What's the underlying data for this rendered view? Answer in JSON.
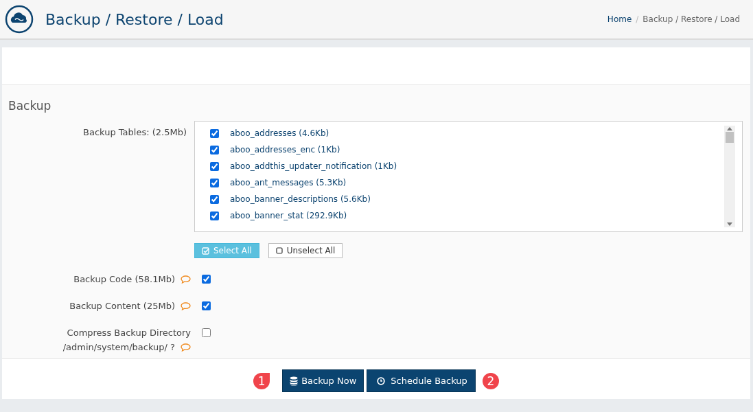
{
  "header": {
    "title": "Backup / Restore / Load",
    "breadcrumb": [
      {
        "label": "Home",
        "link": true
      },
      {
        "label": "Backup / Restore / Load",
        "link": false
      }
    ],
    "separator": "/"
  },
  "section": {
    "heading": "Backup"
  },
  "tables": {
    "label": "Backup Tables: (2.5Mb)",
    "items": [
      {
        "name": "aboo_addresses (4.6Kb)",
        "checked": true
      },
      {
        "name": "aboo_addresses_enc (1Kb)",
        "checked": true
      },
      {
        "name": "aboo_addthis_updater_notification (1Kb)",
        "checked": true
      },
      {
        "name": "aboo_ant_messages (5.3Kb)",
        "checked": true
      },
      {
        "name": "aboo_banner_descriptions (5.6Kb)",
        "checked": true
      },
      {
        "name": "aboo_banner_stat (292.9Kb)",
        "checked": true
      }
    ],
    "buttons": [
      {
        "label": "Select All",
        "kind": "select"
      },
      {
        "label": "Unselect All",
        "kind": "unselect"
      }
    ]
  },
  "options": [
    {
      "label": [
        "Backup Code (58.1Mb)"
      ],
      "checked": true
    },
    {
      "label": [
        "Backup Content (25Mb)"
      ],
      "checked": true
    },
    {
      "label": [
        "Compress Backup Directory",
        "/admin/system/backup/ ?"
      ],
      "checked": false
    }
  ],
  "actions": [
    {
      "label": "Backup Now",
      "kind": "backup",
      "callout": "1"
    },
    {
      "label": "Schedule Backup",
      "kind": "schedule",
      "callout": "2"
    }
  ]
}
